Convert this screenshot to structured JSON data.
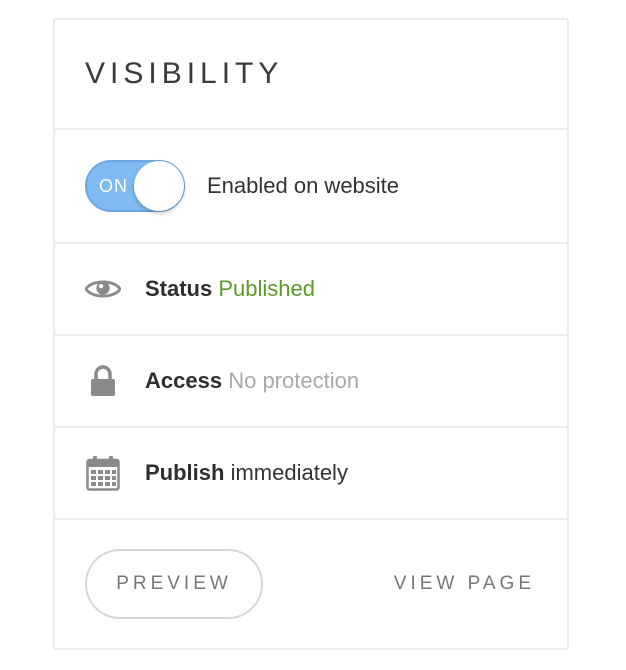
{
  "panel": {
    "title": "VISIBILITY"
  },
  "toggle": {
    "state_label": "ON",
    "is_on": true,
    "caption": "Enabled on website",
    "color": "#7fbaf0"
  },
  "rows": [
    {
      "icon": "eye-icon",
      "label": "Status",
      "value": "Published",
      "value_color": "#5c9a2a"
    },
    {
      "icon": "lock-icon",
      "label": "Access",
      "value": "No protection",
      "value_color": "#a9a9a9"
    },
    {
      "icon": "calendar-icon",
      "label": "Publish",
      "value": "immediately",
      "value_color": "#333333"
    }
  ],
  "footer": {
    "preview_label": "PREVIEW",
    "view_page_label": "VIEW PAGE"
  }
}
